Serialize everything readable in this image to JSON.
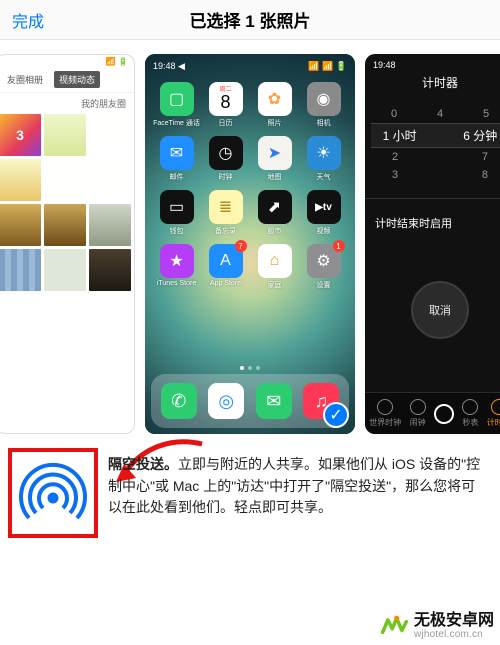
{
  "nav": {
    "done": "完成",
    "title": "已选择 1 张照片"
  },
  "left_panel": {
    "status": "📶 🔋",
    "tabs": {
      "albums": "友圈相册",
      "video": "视频动态"
    },
    "friends_label": "我的朋友圈",
    "promo_tile": "3"
  },
  "mid_home": {
    "status": {
      "left": "19:48 ◀",
      "right": "📶 📶 🔋"
    },
    "apps": [
      {
        "name": "FaceTime 通话",
        "color": "#2ecc71",
        "glyph": "▢"
      },
      {
        "name": "日历",
        "color": "#ffffff",
        "glyph": "8",
        "glyphColor": "#000",
        "sub": "周二"
      },
      {
        "name": "照片",
        "color": "#ffffff",
        "glyph": "✿",
        "glyphColor": "#ff9f43"
      },
      {
        "name": "相机",
        "color": "#8a8a8a",
        "glyph": "◉"
      },
      {
        "name": "邮件",
        "color": "#1f8fff",
        "glyph": "✉"
      },
      {
        "name": "时钟",
        "color": "#111111",
        "glyph": "◷"
      },
      {
        "name": "地图",
        "color": "#f4f3ee",
        "glyph": "➤",
        "glyphColor": "#2b7de9"
      },
      {
        "name": "天气",
        "color": "#2a8bd6",
        "glyph": "☀"
      },
      {
        "name": "钱包",
        "color": "#111111",
        "glyph": "▭"
      },
      {
        "name": "备忘录",
        "color": "#fff7b0",
        "glyph": "≣",
        "glyphColor": "#b08b1e"
      },
      {
        "name": "股市",
        "color": "#111111",
        "glyph": "⬈"
      },
      {
        "name": "视频",
        "color": "#111111",
        "glyph": "tv",
        "label_override": "视频"
      },
      {
        "name": "iTunes Store",
        "color": "#b53df5",
        "glyph": "★"
      },
      {
        "name": "App Store",
        "color": "#1f8fff",
        "glyph": "A",
        "badge": "7"
      },
      {
        "name": "家庭",
        "color": "#ffffff",
        "glyph": "⌂",
        "glyphColor": "#ff9500"
      },
      {
        "name": "设置",
        "color": "#8e8e93",
        "glyph": "⚙",
        "badge": "1"
      }
    ],
    "dock": [
      {
        "name": "phone",
        "color": "#2ecc71",
        "glyph": "✆"
      },
      {
        "name": "safari",
        "color": "#ffffff",
        "glyph": "◎",
        "glyphColor": "#1f8fff"
      },
      {
        "name": "messages",
        "color": "#2ecc71",
        "glyph": "✉"
      },
      {
        "name": "music",
        "color": "#ff3858",
        "glyph": "♫"
      }
    ],
    "check_glyph": "✓"
  },
  "right_timer": {
    "status_left": "19:48",
    "title": "计时器",
    "rows": {
      "above": [
        "0",
        "4",
        "5"
      ],
      "selected": [
        "1 小时",
        "",
        "6 分钟"
      ],
      "below": [
        "2",
        "",
        "7"
      ],
      "below2": [
        "3",
        "",
        "8"
      ]
    },
    "end_label": "计时结束时启用",
    "chevron": "›",
    "cancel": "取消",
    "tabs": [
      "世界时钟",
      "闹钟",
      "秒表",
      "计时器"
    ]
  },
  "airdrop": {
    "title": "隔空投送。",
    "body": "立即与附近的人共享。如果他们从 iOS 设备的\"控制中心\"或 Mac 上的\"访达\"中打开了\"隔空投送\"，那么您将可以在此处看到他们。轻点即可共享。"
  },
  "watermark": {
    "name": "无极安卓网",
    "domain": "wjhotel.com.cn"
  }
}
